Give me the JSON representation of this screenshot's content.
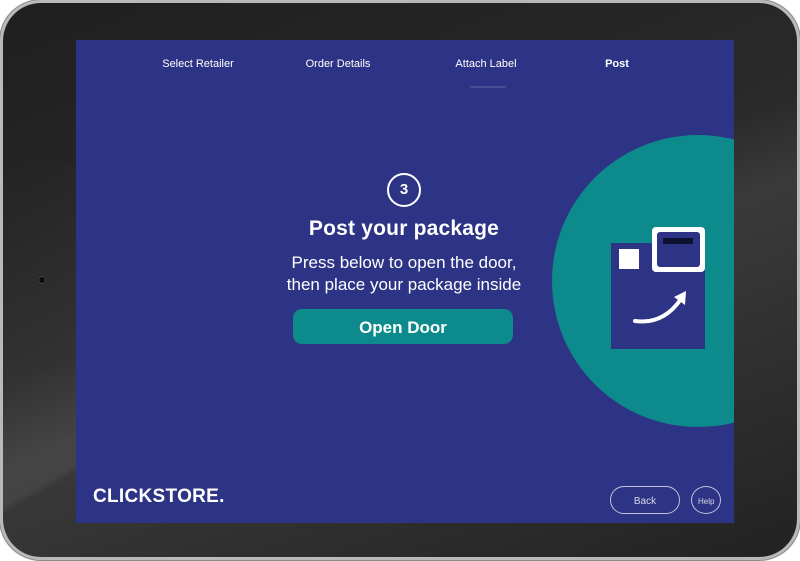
{
  "steps": [
    {
      "label": "Select Retailer",
      "active": false
    },
    {
      "label": "Order Details",
      "active": false
    },
    {
      "label": "Attach Label",
      "active": false
    },
    {
      "label": "Post",
      "active": true
    }
  ],
  "main": {
    "step_number": "3",
    "title": "Post your package",
    "instruction_line1": "Press below to open the door,",
    "instruction_line2": "then place your package inside",
    "open_door_label": "Open Door"
  },
  "footer": {
    "logo": "CLICKSTORE.",
    "back_label": "Back",
    "help_label": "Help"
  },
  "colors": {
    "screen_background": "#2e3485",
    "accent_teal": "#0d8a8c",
    "text": "#ffffff"
  },
  "icons": {
    "illustration": "locker-box-icon"
  }
}
